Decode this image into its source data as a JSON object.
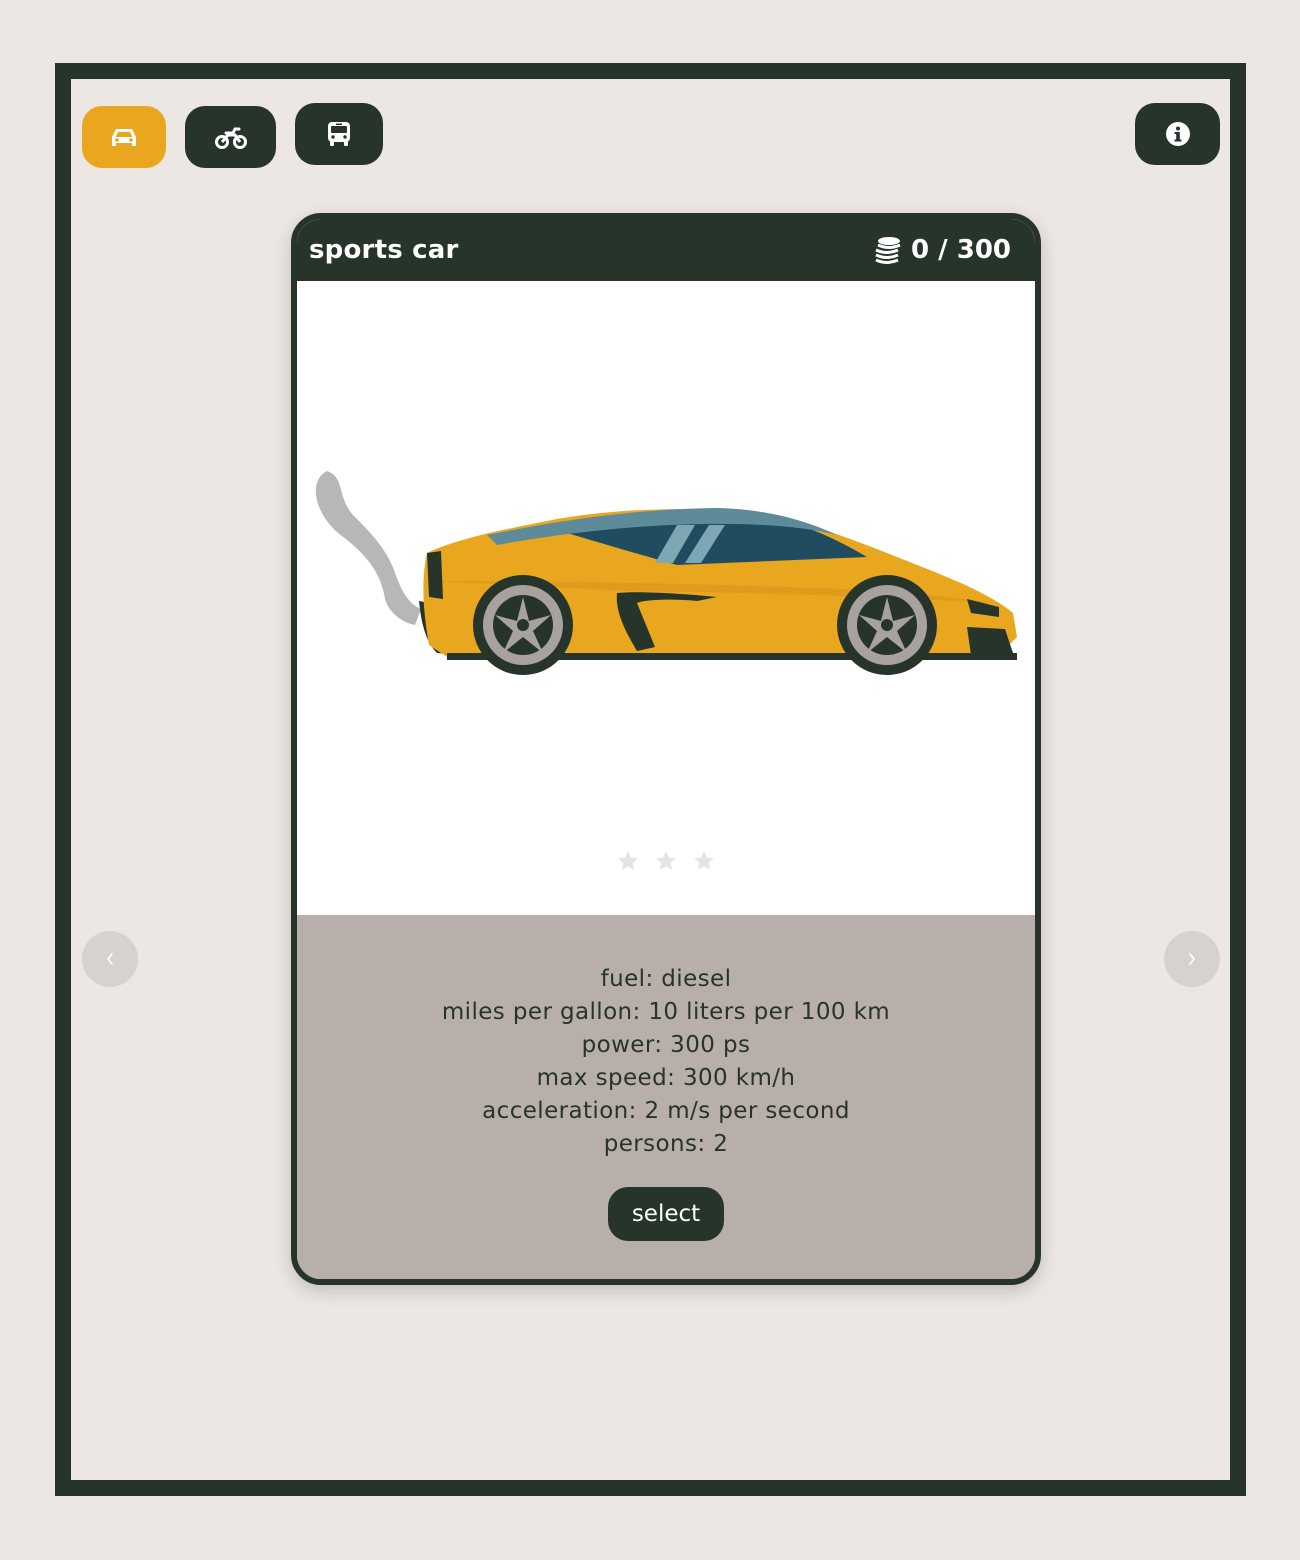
{
  "categories": [
    {
      "name": "car",
      "icon": "car-icon",
      "active": true
    },
    {
      "name": "motorcycle",
      "icon": "motorcycle-icon",
      "active": false
    },
    {
      "name": "bus",
      "icon": "bus-icon",
      "active": false
    }
  ],
  "info_icon": "info-icon",
  "card": {
    "title": "sports car",
    "price": "0 / 300",
    "price_icon": "coins-icon",
    "rating": {
      "filled": 0,
      "max": 3
    },
    "specs": [
      "fuel: diesel",
      "miles per gallon: 10 liters per 100 km",
      "power: 300 ps",
      "max speed: 300 km/h",
      "acceleration: 2 m/s per second",
      "persons: 2"
    ],
    "select_label": "select"
  },
  "nav": {
    "prev_icon": "chevron-left-icon",
    "next_icon": "chevron-right-icon"
  },
  "colors": {
    "dark": "#26342a",
    "accent": "#e9a71f",
    "background": "#ece7e2",
    "specs_panel": "#b8afab"
  }
}
